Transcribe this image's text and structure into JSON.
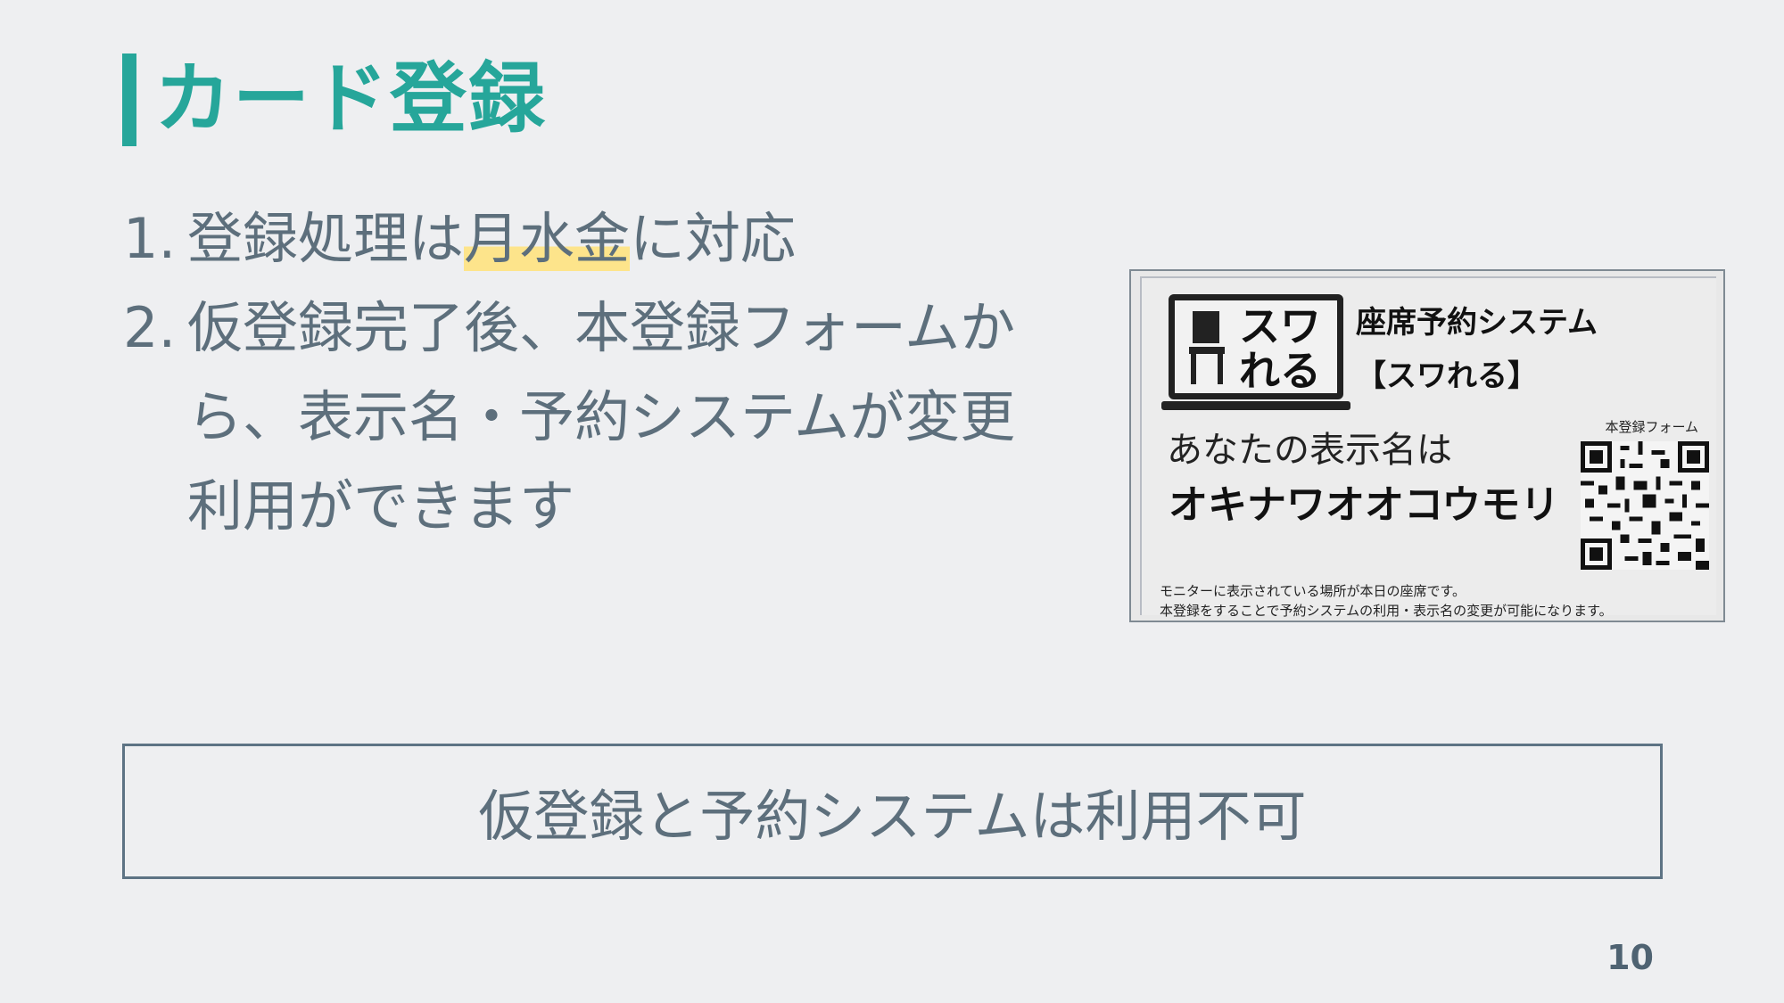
{
  "slide": {
    "title": "カード登録",
    "items": [
      {
        "num": "1.",
        "pre": "登録処理は",
        "highlight": "月水金",
        "post": "に対応"
      },
      {
        "num": "2.",
        "text": "仮登録完了後、本登録フォームから、表示名・予約システムが変更利用ができます"
      }
    ],
    "note": "仮登録と予約システムは利用不可",
    "page_number": "10"
  },
  "card": {
    "logo_text": "スワれる",
    "system_title": "座席予約システム",
    "system_sub": "【スワれる】",
    "display_label": "あなたの表示名は",
    "display_name": "オキナワオオコウモリ",
    "qr_label": "本登録フォーム",
    "footer_line1": "モニターに表示されている場所が本日の座席です。",
    "footer_line2": "本登録をすることで予約システムの利用・表示名の変更が可能になります。"
  },
  "colors": {
    "accent": "#26a69a",
    "text": "#5d6f7c",
    "highlight": "#fde48b",
    "border": "#5d7384"
  }
}
